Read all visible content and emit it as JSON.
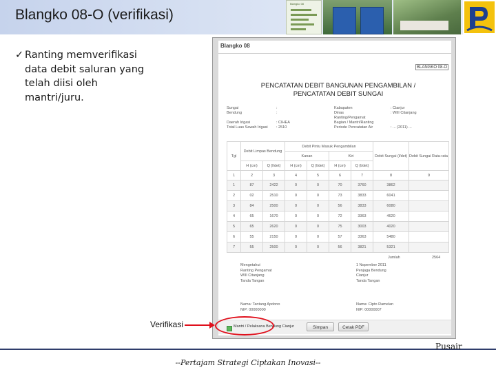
{
  "slide": {
    "title": "Blangko 08-O (verifikasi)",
    "bullet_mark": "✓",
    "bullet_text": "Ranting memverifikasi data debit saluran yang telah diisi oleh mantri/juru.",
    "callout_label": "Verifikasi",
    "org_name": "Pusair",
    "footer_tagline": "--Pertajam Strategi Ciptakan Inovasi--",
    "accent_color": "#2f3d6b",
    "highlight_color": "#e0101c"
  },
  "header_thumbs": {
    "form_label": "Blangko 08",
    "logo_icon": "pu-ministry-logo-icon"
  },
  "form": {
    "title": "Blangko 08",
    "code": "BLANGKO 08-O",
    "heading_line1": "PENCATATAN DEBIT BANGUNAN PENGAMBILAN /",
    "heading_line2": "PENCATATAN DEBIT SUNGAI",
    "info_left_labels": [
      "Sungai",
      "Bendung",
      "",
      "Daerah Irigasi",
      "Total Luas Sawah Irigasi"
    ],
    "info_left_values": [
      ":",
      ":",
      "",
      ": CIHEA",
      ": 2510"
    ],
    "info_right_labels": [
      "Kabupaten",
      "Dinas",
      "Ranting/Pengamat",
      "Bagian / Mantri/Ranting",
      "Periode Pencatatan Air"
    ],
    "info_right_values": [
      ": Cianjur",
      ": WIII Citanjang",
      "",
      "",
      ": ... (2011) ..."
    ],
    "table": {
      "col_tgl": "Tgl",
      "col_limpas": "Debit Limpas Bendung",
      "col_pintu": "Debit Pintu Masuk Pengambilan",
      "col_sungai": "Debit Sungai (l/det)",
      "col_rerata": "Debit Sungai Rata-rata (l/det)",
      "sub_kanan": "Kanan",
      "sub_kiri": "Kiri",
      "sub_cols": [
        "H (cm)",
        "Q (l/det)",
        "H (cm)",
        "Q (l/det)",
        "H (cm)",
        "Q (l/det)"
      ],
      "index_row": [
        "1",
        "2",
        "3",
        "4",
        "5",
        "6",
        "7",
        "8",
        "9"
      ],
      "rows": [
        [
          "1",
          "87",
          "2422",
          "0",
          "0",
          "70",
          "3760",
          "3862",
          ""
        ],
        [
          "2",
          "02",
          "2510",
          "0",
          "0",
          "73",
          "3833",
          "6041",
          ""
        ],
        [
          "3",
          "84",
          "2500",
          "0",
          "0",
          "56",
          "3833",
          "6080",
          ""
        ],
        [
          "4",
          "65",
          "1670",
          "0",
          "0",
          "72",
          "3363",
          "4620",
          ""
        ],
        [
          "5",
          "65",
          "2620",
          "0",
          "0",
          "75",
          "3003",
          "4020",
          ""
        ],
        [
          "6",
          "55",
          "2150",
          "0",
          "0",
          "57",
          "3363",
          "5480",
          ""
        ],
        [
          "7",
          "55",
          "2500",
          "0",
          "0",
          "56",
          "3821",
          "5321",
          ""
        ]
      ],
      "total_label": "Jumlah",
      "total_value": "2564"
    },
    "sign_left_1": [
      "Mengetahui",
      "Ranting Pengamat",
      "WIII Citanjang",
      "Tanda Tangan"
    ],
    "sign_right_1": [
      "1 Nopember 2011",
      "Penjaga Bendung",
      "Cianjur",
      "Tanda Tangan"
    ],
    "sign_left_2": [
      "Nama: Tantang Apdono",
      "NIP: 00000000"
    ],
    "sign_right_2": [
      "Nama: Cipto Ramelan",
      "NIP: 00000007"
    ],
    "verify_checkbox_label": "Mantri / Pelaksana Bendung Cianjur",
    "save_button": "Simpan",
    "pdf_button": "Cetak PDF"
  }
}
